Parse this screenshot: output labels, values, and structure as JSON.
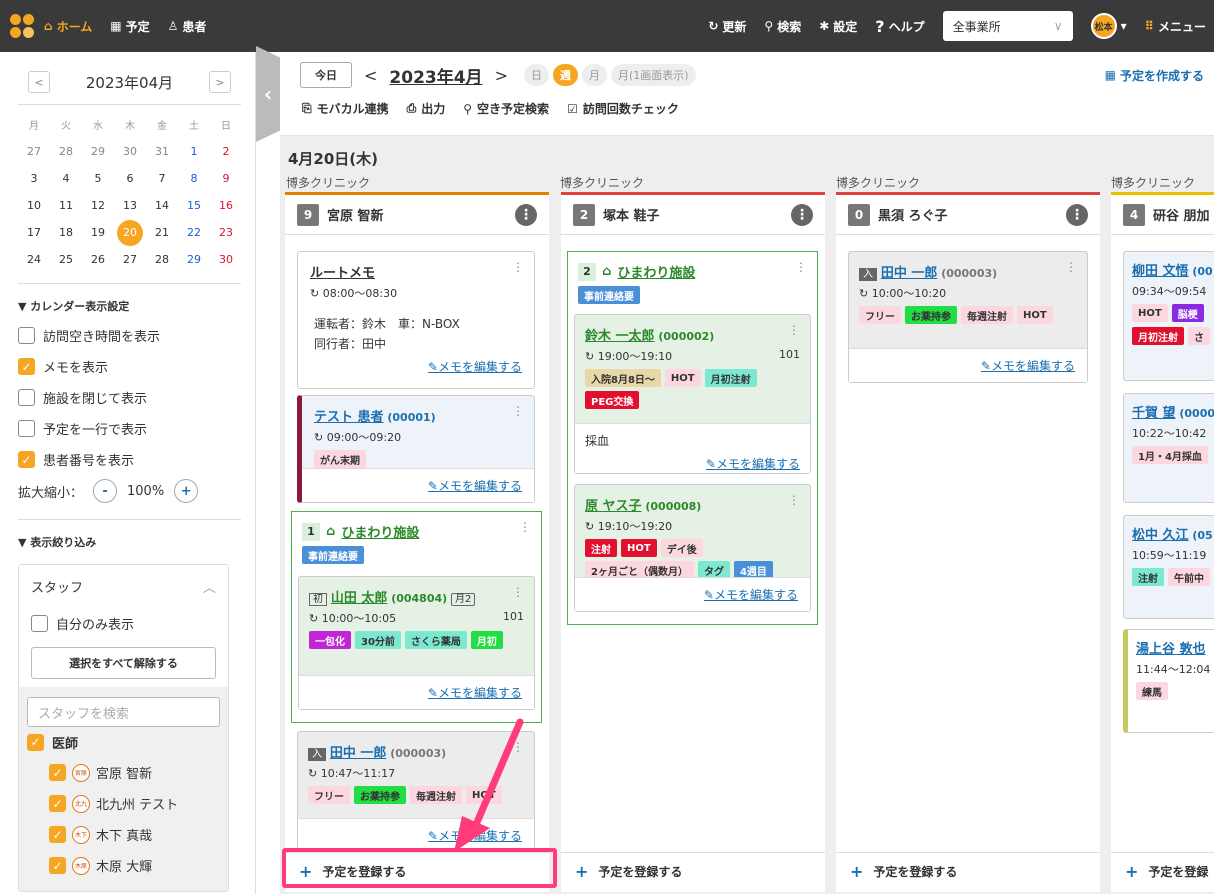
{
  "topbar": {
    "nav": [
      {
        "label": "ホーム",
        "icon": "home-icon"
      },
      {
        "label": "予定",
        "icon": "calendar-icon"
      },
      {
        "label": "患者",
        "icon": "person-icon"
      }
    ],
    "right": [
      {
        "label": "更新",
        "icon": "refresh-icon"
      },
      {
        "label": "検索",
        "icon": "search-icon"
      },
      {
        "label": "設定",
        "icon": "gear-icon"
      },
      {
        "label": "ヘルプ",
        "icon": "help-icon"
      }
    ],
    "office_select": "全事業所",
    "user_avatar": "松本",
    "menu_label": "メニュー"
  },
  "sidebar": {
    "month": "2023年04月",
    "prev": "<",
    "next": ">",
    "dow": [
      "月",
      "火",
      "水",
      "木",
      "金",
      "土",
      "日"
    ],
    "weeks": [
      [
        "27",
        "28",
        "29",
        "30",
        "31",
        "1",
        "2"
      ],
      [
        "3",
        "4",
        "5",
        "6",
        "7",
        "8",
        "9"
      ],
      [
        "10",
        "11",
        "12",
        "13",
        "14",
        "15",
        "16"
      ],
      [
        "17",
        "18",
        "19",
        "20",
        "21",
        "22",
        "23"
      ],
      [
        "24",
        "25",
        "26",
        "27",
        "28",
        "29",
        "30"
      ]
    ],
    "today": "20",
    "display_settings_title": "▼ カレンダー表示設定",
    "options": [
      {
        "label": "訪問空き時間を表示",
        "checked": false
      },
      {
        "label": "メモを表示",
        "checked": true
      },
      {
        "label": "施設を閉じて表示",
        "checked": false
      },
      {
        "label": "予定を一行で表示",
        "checked": false
      },
      {
        "label": "患者番号を表示",
        "checked": true
      }
    ],
    "zoom_label": "拡大縮小：",
    "zoom_value": "100%",
    "filter_title": "▼ 表示絞り込み",
    "staff_label": "スタッフ",
    "self_only": "自分のみ表示",
    "deselect_all": "選択をすべて解除する",
    "search_placeholder": "スタッフを検索",
    "group": "医師",
    "staff": [
      {
        "short": "宮原",
        "name": "宮原 智新"
      },
      {
        "short": "北九",
        "name": "北九州 テスト"
      },
      {
        "short": "木下",
        "name": "木下 真哉"
      },
      {
        "short": "木原",
        "name": "木原 大輝"
      }
    ]
  },
  "toolbar": {
    "today": "今日",
    "prev": "<",
    "next": ">",
    "month": "2023年4月",
    "views": [
      "日",
      "週",
      "月",
      "月(1画面表示)"
    ],
    "active_view": "週",
    "create": "予定を作成する",
    "actions": [
      {
        "label": "モバカル連携",
        "icon": "link-icon"
      },
      {
        "label": "出力",
        "icon": "print-icon"
      },
      {
        "label": "空き予定検索",
        "icon": "search-icon"
      },
      {
        "label": "訪問回数チェック",
        "icon": "calendar-check-icon"
      }
    ]
  },
  "date_header": "4月20日(木)",
  "columns": [
    {
      "clinic": "博多クリニック",
      "count": "9",
      "name": "宮原 智新",
      "color": "#e08000"
    },
    {
      "clinic": "博多クリニック",
      "count": "2",
      "name": "塚本 鞋子",
      "color": "#e04040"
    },
    {
      "clinic": "博多クリニック",
      "count": "0",
      "name": "黒須 ろぐ子",
      "color": "#e04040"
    },
    {
      "clinic": "博多クリニック",
      "count": "4",
      "name": "研谷 朋加",
      "color": "#e8c000"
    }
  ],
  "col1": {
    "route_memo": {
      "title": "ルートメモ",
      "time": "08:00〜08:30",
      "driver": "運転者：鈴木　車：N-BOX",
      "companion": "同行者：田中",
      "edit": "メモを編集する"
    },
    "test": {
      "name": "テスト 患者",
      "id": "(00001)",
      "time": "09:00〜09:20",
      "tag": "がん末期",
      "edit": "メモを編集する"
    },
    "facility": {
      "num": "1",
      "name": "ひまわり施設",
      "badge": "事前連絡要"
    },
    "yamada": {
      "init": "初",
      "name": "山田 太郎",
      "id": "(004804)",
      "month": "月2",
      "time": "10:00〜10:05",
      "room": "101",
      "tags": [
        "一包化",
        "30分前",
        "さくら薬局",
        "月初"
      ],
      "edit": "メモを編集する"
    },
    "tanaka": {
      "in": "入",
      "name": "田中 一郎",
      "id": "(000003)",
      "time": "10:47〜11:17",
      "tags": [
        "フリー",
        "お薬持参",
        "毎週注射",
        "HOT"
      ],
      "edit": "メモを編集する"
    },
    "add": "予定を登録する"
  },
  "col2": {
    "facility": {
      "num": "2",
      "name": "ひまわり施設",
      "badge": "事前連絡要"
    },
    "suzuki": {
      "name": "鈴木 一太郎",
      "id": "(000002)",
      "time": "19:00〜19:10",
      "room": "101",
      "tags": [
        "入院8月8日〜",
        "HOT",
        "月初注射",
        "PEG交換"
      ],
      "memo": "採血",
      "edit": "メモを編集する"
    },
    "hara": {
      "name": "原 ヤス子",
      "id": "(000008)",
      "time": "19:10〜19:20",
      "tags": [
        "注射",
        "HOT",
        "デイ後",
        "2ヶ月ごと（偶数月）",
        "タグ",
        "4週目"
      ],
      "edit": "メモを編集する"
    },
    "add": "予定を登録する"
  },
  "col3": {
    "tanaka": {
      "in": "入",
      "name": "田中 一郎",
      "id": "(000003)",
      "time": "10:00〜10:20",
      "tags": [
        "フリー",
        "お薬持参",
        "毎週注射",
        "HOT"
      ],
      "edit": "メモを編集する"
    },
    "add": "予定を登録する"
  },
  "col4": {
    "items": [
      {
        "name": "柳田 文悟",
        "id": "(00",
        "time": "09:34〜09:54",
        "tags": [
          "HOT",
          "脳梗",
          "月初注射",
          "さ"
        ]
      },
      {
        "name": "千賀 望",
        "id": "(0000",
        "time": "10:22〜10:42",
        "tags": [
          "1月・4月採血"
        ]
      },
      {
        "name": "松中 久江",
        "id": "(05",
        "time": "10:59〜11:19",
        "tags": [
          "注射",
          "午前中"
        ]
      },
      {
        "name": "湯上谷 敦也",
        "id": "",
        "time": "11:44〜12:04",
        "tags": [
          "練馬"
        ]
      }
    ],
    "add": "予定を登録"
  }
}
